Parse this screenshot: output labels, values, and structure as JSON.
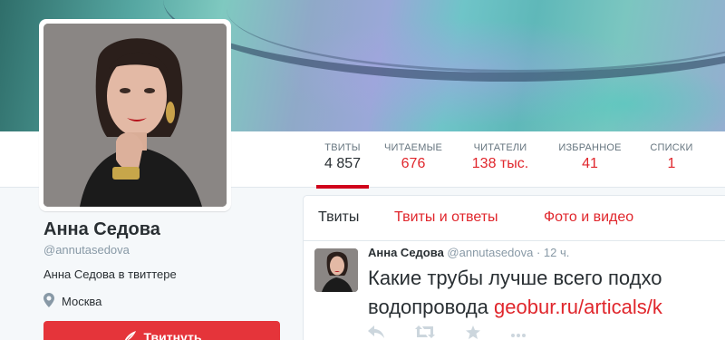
{
  "profile": {
    "name": "Анна Седова",
    "handle": "@annutasedova",
    "bio": "Анна Седова в твиттере",
    "location": "Москва"
  },
  "nav": [
    {
      "label": "ТВИТЫ",
      "value": "4 857"
    },
    {
      "label": "ЧИТАЕМЫЕ",
      "value": "676"
    },
    {
      "label": "ЧИТАТЕЛИ",
      "value": "138 тыс."
    },
    {
      "label": "ИЗБРАННОЕ",
      "value": "41"
    },
    {
      "label": "СПИСКИ",
      "value": "1"
    }
  ],
  "tabs": [
    "Твиты",
    "Твиты и ответы",
    "Фото и видео"
  ],
  "tweet": {
    "author": "Анна Седова",
    "handle": "@annutasedova",
    "separator": "·",
    "time": "12 ч.",
    "text_line1": "Какие трубы лучше всего подхо",
    "text_line2": "водопровода ",
    "link": "geobur.ru/articals/k"
  },
  "tweet_button_label": "Твитнуть",
  "colors": {
    "accent": "#e0262c",
    "button": "#e5343a",
    "active_tab_underline": "#d0021b"
  },
  "icons": [
    "location-pin-icon",
    "quill-icon",
    "reply-icon",
    "retweet-icon",
    "favorite-star-icon",
    "more-icon"
  ]
}
